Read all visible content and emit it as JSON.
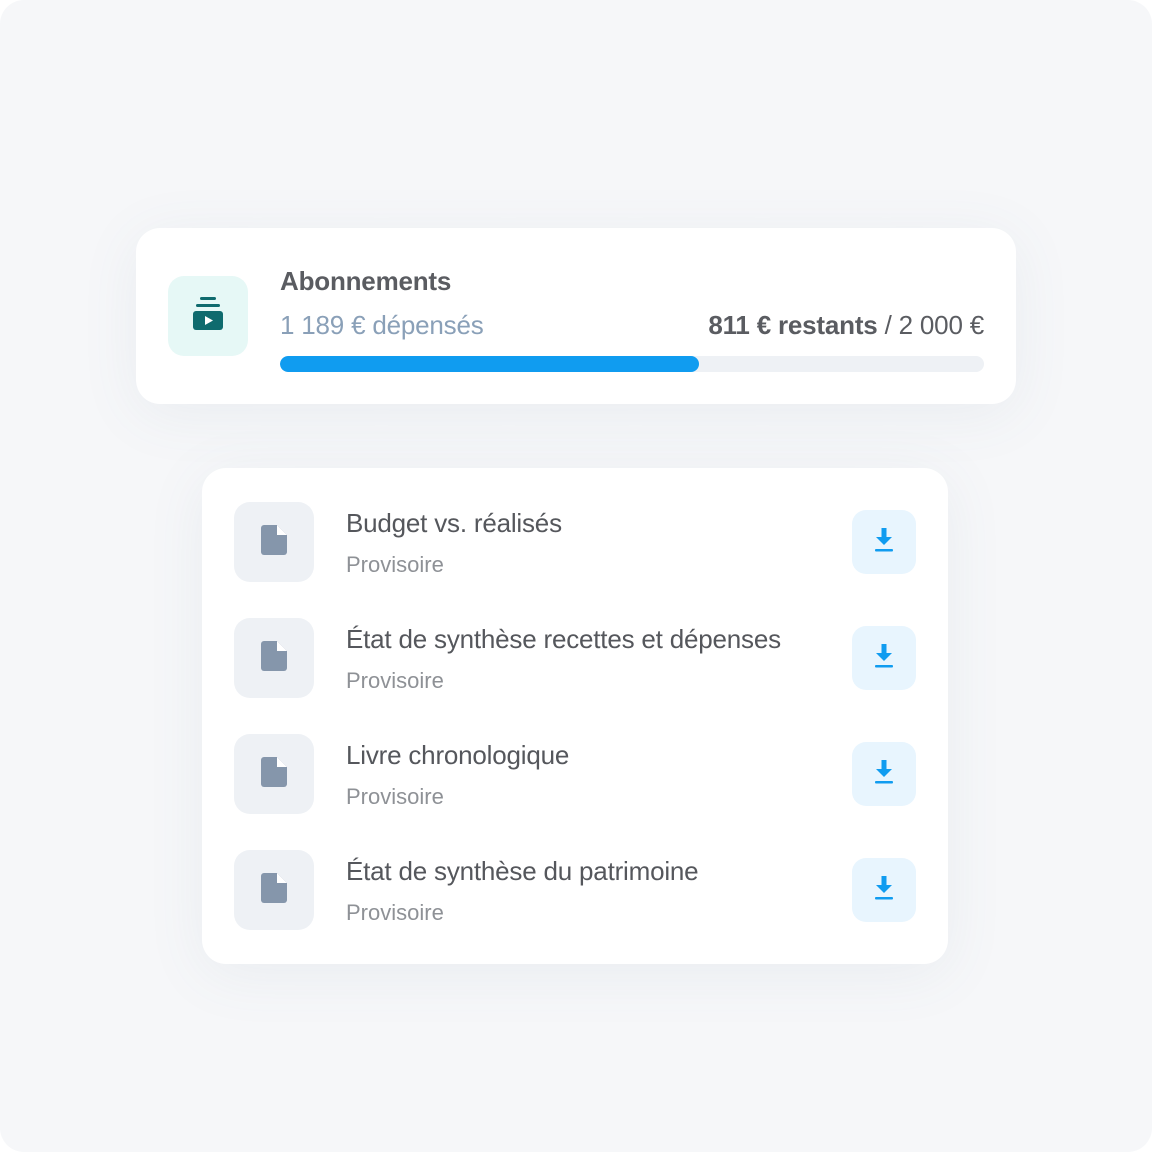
{
  "budget": {
    "category": "Abonnements",
    "category_icon": "subscription-video-icon",
    "spent_label": "1 189 € dépensés",
    "remaining_label": "811 € restants",
    "separator": " / ",
    "total_label": "2 000 €",
    "progress_percent": 59.45,
    "accent_color": "#109cf0",
    "icon_color": "#0f6b6e"
  },
  "documents": {
    "items": [
      {
        "title": "Budget vs. réalisés",
        "status": "Provisoire",
        "icon": "file-icon",
        "action_icon": "download-icon"
      },
      {
        "title": "État de synthèse recettes et dépenses",
        "status": "Provisoire",
        "icon": "file-icon",
        "action_icon": "download-icon"
      },
      {
        "title": "Livre chronologique",
        "status": "Provisoire",
        "icon": "file-icon",
        "action_icon": "download-icon"
      },
      {
        "title": "État de synthèse du patrimoine",
        "status": "Provisoire",
        "icon": "file-icon",
        "action_icon": "download-icon"
      }
    ]
  }
}
